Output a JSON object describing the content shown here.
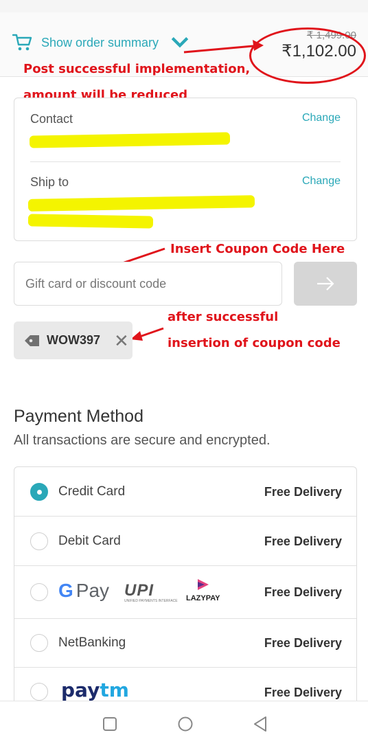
{
  "summary": {
    "toggle_label": "Show order summary",
    "original_price": "₹ 1,499.00",
    "total_price": "₹1,102.00"
  },
  "annotations": {
    "price_note_line1": "Post successful implementation,",
    "price_note_line2": "amount will be reduced",
    "coupon_insert_note": "Insert Coupon Code Here",
    "coupon_applied_note_line1": "after successful",
    "coupon_applied_note_line2": "insertion of coupon code",
    "annotation_color": "#e0141b"
  },
  "contact": {
    "contact_label": "Contact",
    "contact_change": "Change",
    "ship_label": "Ship to",
    "ship_change": "Change"
  },
  "discount": {
    "placeholder": "Gift card or discount code",
    "applied_code": "WOW397"
  },
  "payment": {
    "title": "Payment Method",
    "subtitle": "All transactions are secure and encrypted.",
    "options": [
      {
        "label": "Credit Card",
        "right": "Free Delivery",
        "selected": true
      },
      {
        "label": "Debit Card",
        "right": "Free Delivery",
        "selected": false
      },
      {
        "label": "G Pay",
        "upi": "UPI",
        "upi_sub": "UNIFIED PAYMENTS INTERFACE",
        "lazypay": "LAZYPAY",
        "right": "Free Delivery",
        "selected": false
      },
      {
        "label": "NetBanking",
        "right": "Free Delivery",
        "selected": false
      },
      {
        "label": "paytm",
        "right": "Free Delivery",
        "selected": false
      }
    ]
  },
  "colors": {
    "accent": "#2aa8b8",
    "highlight": "#f4f400"
  }
}
